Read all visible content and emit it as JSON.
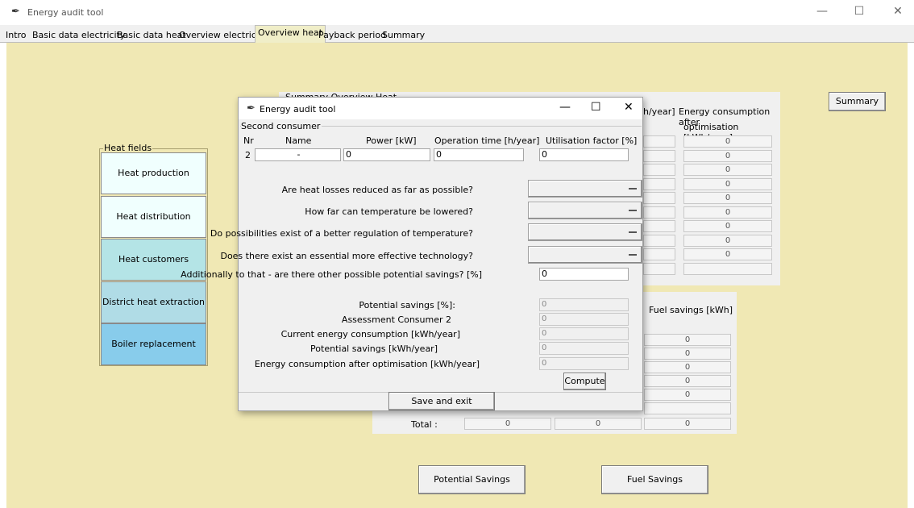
{
  "window": {
    "title": "Energy audit tool"
  },
  "tabs": [
    "Intro",
    "Basic data electricity",
    "Basic data heat",
    "Overview electricity",
    "Overview heat",
    "Payback period",
    "Summary"
  ],
  "active_tab": "Overview heat",
  "heat_fields": {
    "label": "Heat fields",
    "buttons": [
      {
        "label": "Heat production",
        "color": "#f0fffe"
      },
      {
        "label": "Heat distribution",
        "color": "#f0fffe"
      },
      {
        "label": "Heat customers",
        "color": "#b4e4e6"
      },
      {
        "label": "District heat extraction",
        "color": "#b0dce6"
      },
      {
        "label": "Boiler replacement",
        "color": "#88cceb"
      }
    ]
  },
  "summary_panel": {
    "title": "Summary Overview Heat",
    "partial_header": "h/year]",
    "header_line1": "Energy consumption after",
    "header_line2": "optimisation [kWh/year]",
    "values": [
      "0",
      "0",
      "0",
      "0",
      "0",
      "0",
      "0",
      "0",
      "0",
      ""
    ]
  },
  "fuel_panel": {
    "header": "Fuel savings [kWh]",
    "values": [
      "0",
      "0",
      "0",
      "0",
      "0"
    ],
    "total_label": "Total :",
    "totals": [
      "0",
      "0",
      "0"
    ]
  },
  "buttons": {
    "summary": "Summary",
    "potential_savings": "Potential Savings",
    "fuel_savings": "Fuel Savings"
  },
  "dialog": {
    "title": "Energy audit tool",
    "group_label": "Second consumer",
    "columns": {
      "nr": "Nr",
      "name": "Name",
      "power": "Power [kW]",
      "operation": "Operation time [h/year]",
      "utilisation": "Utilisation factor [%]"
    },
    "row": {
      "nr": "2",
      "name": "-",
      "power": "0",
      "operation": "0",
      "utilisation": "0"
    },
    "questions": [
      "Are heat losses reduced as far as possible?",
      "How far can temperature be lowered?",
      "Do possibilities exist of a better regulation of temperature?",
      "Does there exist an essential more effective technology?"
    ],
    "additional_label": "Additionally to that - are there other possible potential savings? [%]",
    "additional_value": "0",
    "results": [
      {
        "label": "Potential savings [%]:",
        "value": "0"
      },
      {
        "label": "Assessment Consumer 2",
        "value": "0"
      },
      {
        "label": "Current energy consumption [kWh/year]",
        "value": "0"
      },
      {
        "label": "Potential savings [kWh/year]",
        "value": "0"
      },
      {
        "label": "Energy consumption after optimisation [kWh/year]",
        "value": "0"
      }
    ],
    "compute_label": "Compute",
    "save_label": "Save and exit"
  },
  "icons": {
    "app": "feather-icon",
    "minimize": "minimize-icon",
    "maximize": "maximize-icon",
    "close": "close-icon"
  }
}
